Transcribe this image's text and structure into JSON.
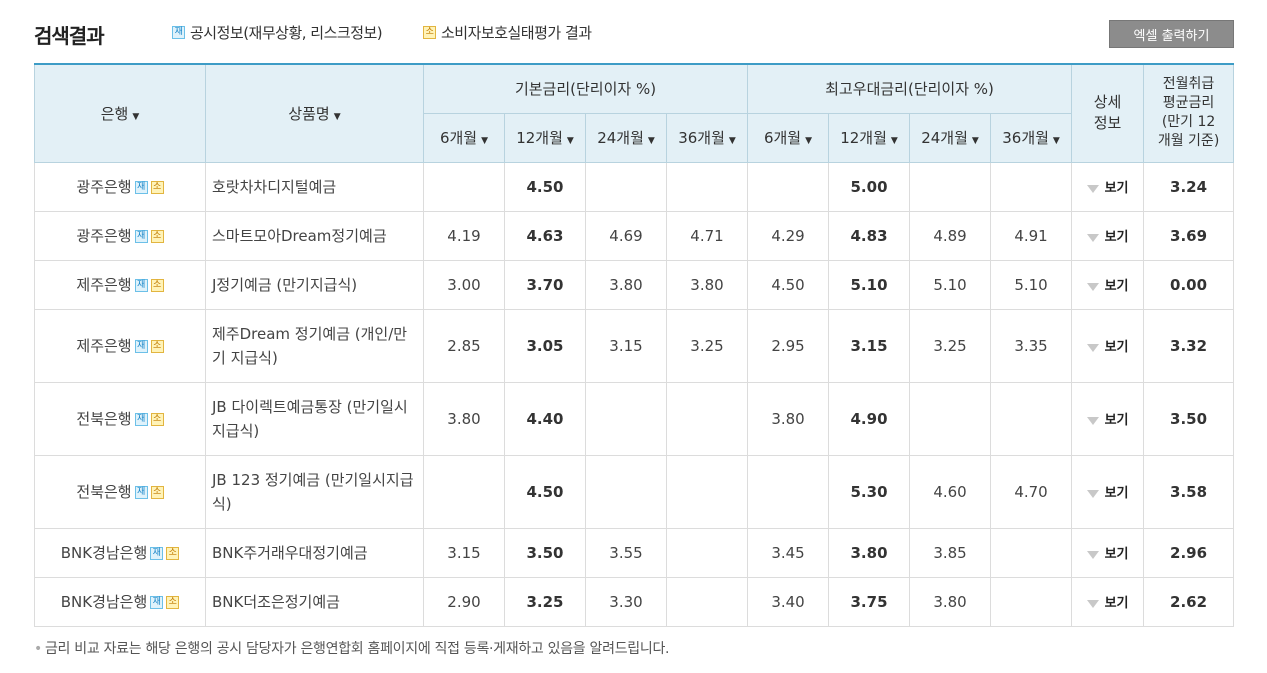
{
  "header": {
    "title": "검색결과",
    "legend_jae_badge": "재",
    "legend_jae_text": "공시정보(재무상황, 리스크정보)",
    "legend_so_badge": "소",
    "legend_so_text": "소비자보호실태평가 결과",
    "excel_button": "엑셀 출력하기"
  },
  "table": {
    "col_bank": "은행",
    "col_product": "상품명",
    "col_base": "기본금리(단리이자 %)",
    "col_max": "최고우대금리(단리이자 %)",
    "col_detail_1": "상세",
    "col_detail_2": "정보",
    "col_avg_1": "전월취급",
    "col_avg_2": "평균금리",
    "col_avg_3": "(만기 12",
    "col_avg_4": "개월 기준)",
    "term_6": "6개월",
    "term_12": "12개월",
    "term_24": "24개월",
    "term_36": "36개월",
    "caret": "▼",
    "badge_jae": "재",
    "badge_so": "소",
    "view_label": "보기",
    "rows": [
      {
        "bank": "광주은행",
        "product": "호랏차차디지털예금",
        "base": [
          "",
          "4.50",
          "",
          ""
        ],
        "max": [
          "",
          "5.00",
          "",
          ""
        ],
        "avg": "3.24"
      },
      {
        "bank": "광주은행",
        "product": "스마트모아Dream정기예금",
        "base": [
          "4.19",
          "4.63",
          "4.69",
          "4.71"
        ],
        "max": [
          "4.29",
          "4.83",
          "4.89",
          "4.91"
        ],
        "avg": "3.69"
      },
      {
        "bank": "제주은행",
        "product": "J정기예금 (만기지급식)",
        "base": [
          "3.00",
          "3.70",
          "3.80",
          "3.80"
        ],
        "max": [
          "4.50",
          "5.10",
          "5.10",
          "5.10"
        ],
        "avg": "0.00"
      },
      {
        "bank": "제주은행",
        "product": "제주Dream 정기예금 (개인/만기 지급식)",
        "base": [
          "2.85",
          "3.05",
          "3.15",
          "3.25"
        ],
        "max": [
          "2.95",
          "3.15",
          "3.25",
          "3.35"
        ],
        "avg": "3.32"
      },
      {
        "bank": "전북은행",
        "product": "JB 다이렉트예금통장 (만기일시지급식)",
        "base": [
          "3.80",
          "4.40",
          "",
          ""
        ],
        "max": [
          "3.80",
          "4.90",
          "",
          ""
        ],
        "avg": "3.50"
      },
      {
        "bank": "전북은행",
        "product": "JB 123 정기예금 (만기일시지급식)",
        "base": [
          "",
          "4.50",
          "",
          ""
        ],
        "max": [
          "",
          "5.30",
          "4.60",
          "4.70"
        ],
        "avg": "3.58"
      },
      {
        "bank": "BNK경남은행",
        "product": "BNK주거래우대정기예금",
        "base": [
          "3.15",
          "3.50",
          "3.55",
          ""
        ],
        "max": [
          "3.45",
          "3.80",
          "3.85",
          ""
        ],
        "avg": "2.96"
      },
      {
        "bank": "BNK경남은행",
        "product": "BNK더조은정기예금",
        "base": [
          "2.90",
          "3.25",
          "3.30",
          ""
        ],
        "max": [
          "3.40",
          "3.75",
          "3.80",
          ""
        ],
        "avg": "2.62"
      }
    ]
  },
  "footnote": {
    "dot": "•",
    "text": "금리 비교 자료는 해당 은행의 공시 담당자가 은행연합회 홈페이지에 직접 등록·게재하고 있음을 알려드립니다."
  }
}
